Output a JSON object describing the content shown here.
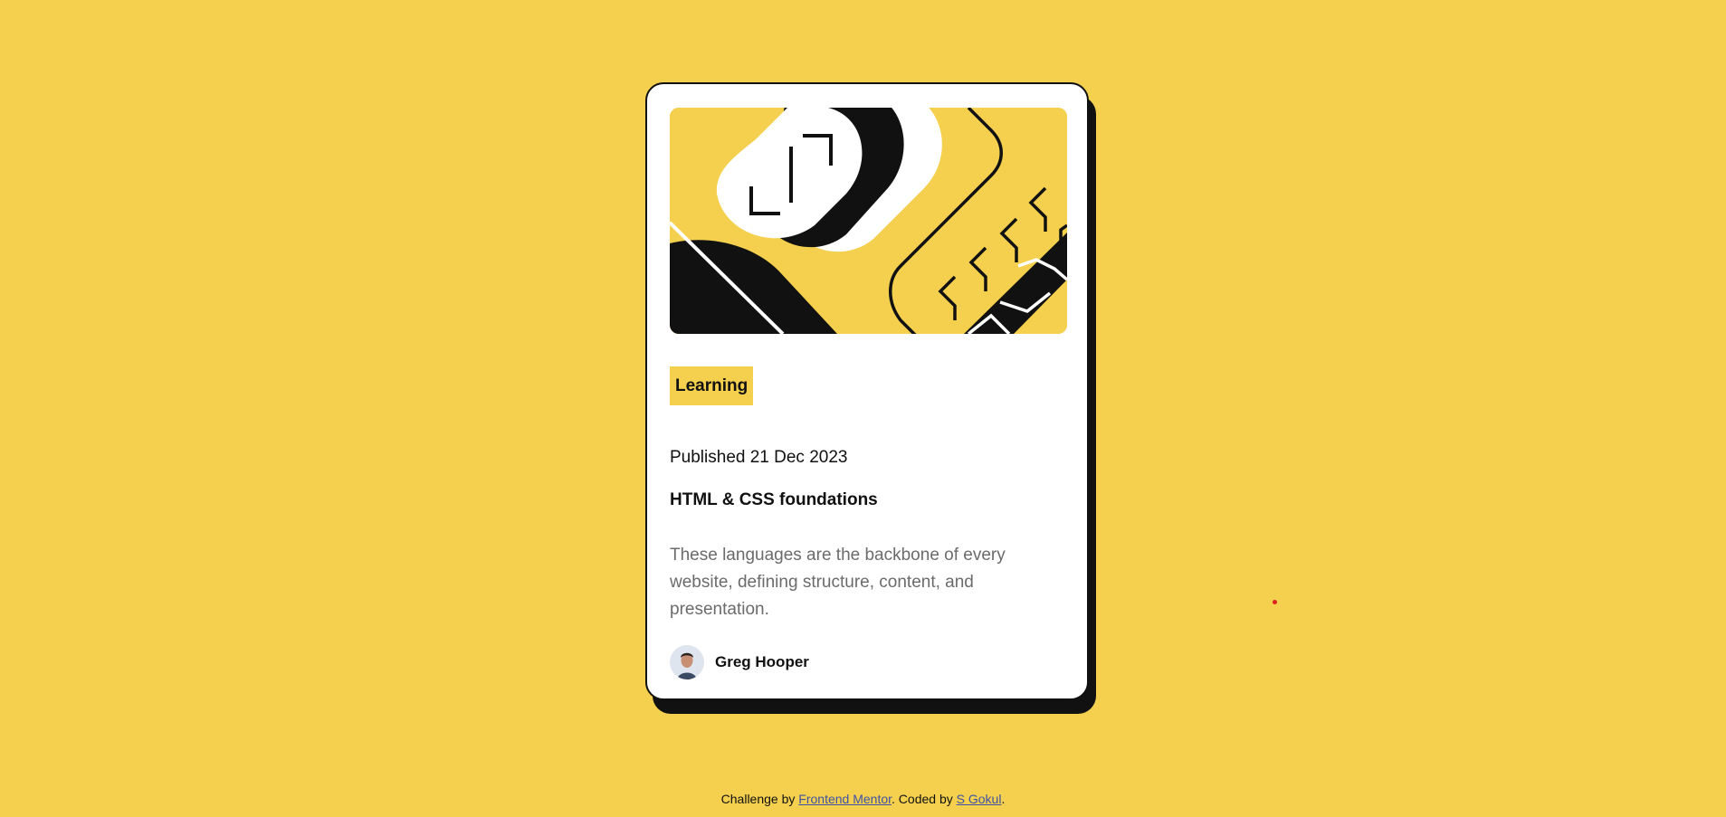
{
  "card": {
    "tag": "Learning",
    "published": "Published 21 Dec 2023",
    "title": "HTML & CSS foundations",
    "description": "These languages are the backbone of every website, defining structure, content, and presentation.",
    "author": {
      "name": "Greg Hooper",
      "avatar_icon": "user-avatar-photo"
    },
    "hero_icon": "abstract-geometric-illustration"
  },
  "attribution": {
    "prefix": "Challenge by ",
    "link1": "Frontend Mentor",
    "middle": ". Coded by ",
    "link2": "S Gokul",
    "suffix": "."
  },
  "colors": {
    "background": "#f4d04e",
    "card": "#ffffff",
    "ink": "#111111",
    "muted_text": "#6b6b6b",
    "link": "#3e52a3"
  }
}
